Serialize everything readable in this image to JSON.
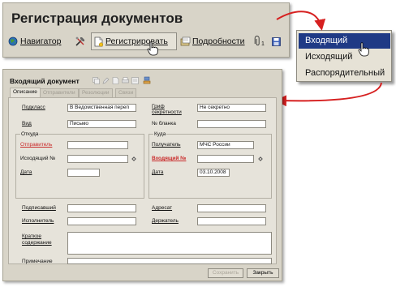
{
  "toolbar_window": {
    "title": "Регистрация документов",
    "navigator_label": "Навигатор",
    "register_label": "Регистрировать",
    "details_label": "Подробности",
    "attachments_count": "1"
  },
  "register_menu": {
    "items": [
      "Входящий",
      "Исходящий",
      "Распорядительный"
    ],
    "selected_index": 0
  },
  "form": {
    "title": "Входящий документ",
    "tabs": [
      "Описание",
      "Отправители",
      "Резолюции",
      "Связи"
    ],
    "active_tab": 0,
    "fields": {
      "subclass_label": "Подкласс",
      "subclass_value": "В Ведомственная переп",
      "type_label": "Вид",
      "type_value": "Письмо",
      "secrecy_label_1": "Гриф",
      "secrecy_label_2": "секретности",
      "secrecy_value": "Не секретно",
      "form_no_label": "№ бланка"
    },
    "from_group": {
      "title": "Откуда",
      "sender_label": "Отправитель",
      "outgoing_no_label": "Исходящий №",
      "date_label": "Дата"
    },
    "to_group": {
      "title": "Куда",
      "recipient_label": "Получатель",
      "recipient_value": "МЧС России",
      "incoming_no_label": "Входящий №",
      "date_label": "Дата",
      "date_value": "03.10.2008"
    },
    "signed_label": "Подписавший",
    "executor_label": "Исполнитель",
    "addressee_label": "Адресат",
    "holder_label": "Держатель",
    "summary_label_1": "Краткое",
    "summary_label_2": "содержание",
    "note_label": "Примечание",
    "save_label": "Сохранить",
    "close_label": "Закрыть"
  },
  "colors": {
    "window_bg": "#d8d4c8",
    "panel_bg": "#e6e3da",
    "menu_selected_bg": "#1f3a85",
    "arrow_red": "#d62020",
    "required_label": "#c92a2a"
  }
}
